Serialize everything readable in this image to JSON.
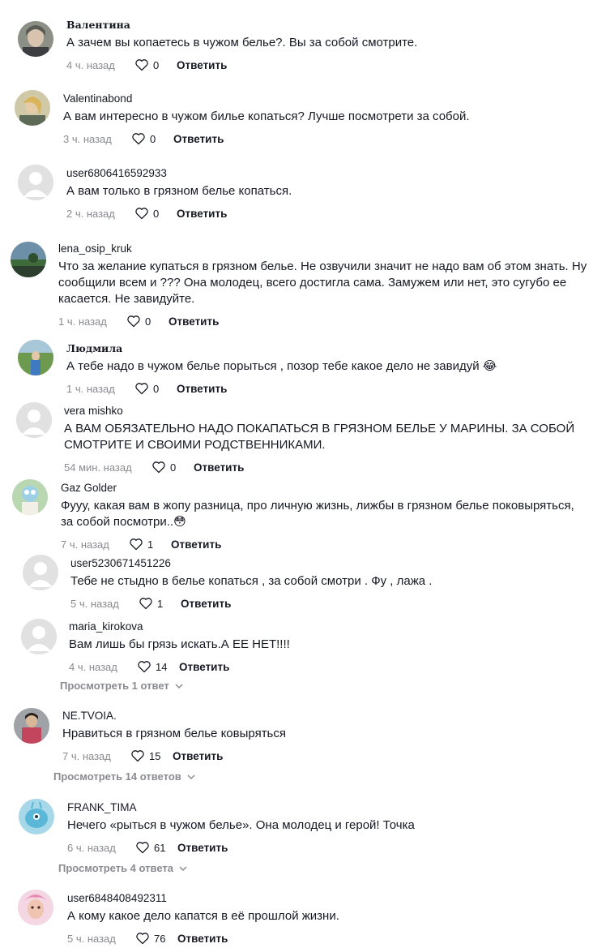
{
  "reply_label": "Ответить",
  "comments": [
    {
      "user": "Валентина",
      "text": "А зачем вы копаетесь в чужом белье?. Вы за собой смотрите.",
      "time": "4 ч. назад",
      "likes": "0"
    },
    {
      "user": "Valentinabond",
      "text": "А вам интересно в чужом билье копаться? Лучше посмотрети за собой.",
      "time": "3 ч. назад",
      "likes": "0"
    },
    {
      "user": "user6806416592933",
      "text": "А вам только в грязном белье копаться.",
      "time": "2 ч. назад",
      "likes": "0"
    },
    {
      "user": "lena_osip_kruk",
      "text": "Что за желание купаться в грязном белье. Не озвучили значит не надо вам об этом знать. Ну сообщили всем и ??? Она молодец, всего достигла сама. Замужем или нет, это сугубо ее касается. Не завидуйте.",
      "time": "1 ч. назад",
      "likes": "0"
    },
    {
      "user": "Людмила",
      "text": "А тебе надо в чужом белье порыться , позор тебе какое дело не завидуй 😂",
      "time": "1 ч. назад",
      "likes": "0"
    },
    {
      "user": "vera mishko",
      "text": "А ВАМ ОБЯЗАТЕЛЬНО НАДО ПОКАПАТЬСЯ В ГРЯЗНОМ БЕЛЬЕ У МАРИНЫ. ЗА СОБОЙ СМОТРИТЕ И СВОИМИ РОДСТВЕННИКАМИ.",
      "time": "54 мин. назад",
      "likes": "0"
    },
    {
      "user": "Gaz Golder",
      "text": "Фууу, какая вам в жопу разница, про личную жизнь, лижбы в грязном белье поковыряться, за собой посмотри..😳",
      "time": "7 ч. назад",
      "likes": "1"
    },
    {
      "user": "user5230671451226",
      "text": "Тебе не стыдно в белье копаться , за собой смотри . Фу , лажа .",
      "time": "5 ч. назад",
      "likes": "1"
    },
    {
      "user": "maria_kirokova",
      "text": "Вам лишь бы грязь искать.А ЕЕ НЕТ!!!!",
      "time": "4 ч. назад",
      "likes": "14"
    },
    {
      "user": "NE.TVOIA.",
      "text": "Нравиться в грязном белье ковыряться",
      "time": "7 ч. назад",
      "likes": "15"
    },
    {
      "user": "FRANK_TIMA",
      "text": "Нечего «рыться в чужом белье». Она молодец и герой! Точка",
      "time": "6 ч. назад",
      "likes": "61"
    },
    {
      "user": "user6848408492311",
      "text": "А кому какое дело капатся в её прошлой жизни.",
      "time": "5 ч. назад",
      "likes": "76"
    }
  ],
  "view_more": [
    {
      "label": "Просмотреть 1 ответ"
    },
    {
      "label": "Просмотреть 14 ответов"
    },
    {
      "label": "Просмотреть 4 ответа"
    }
  ]
}
